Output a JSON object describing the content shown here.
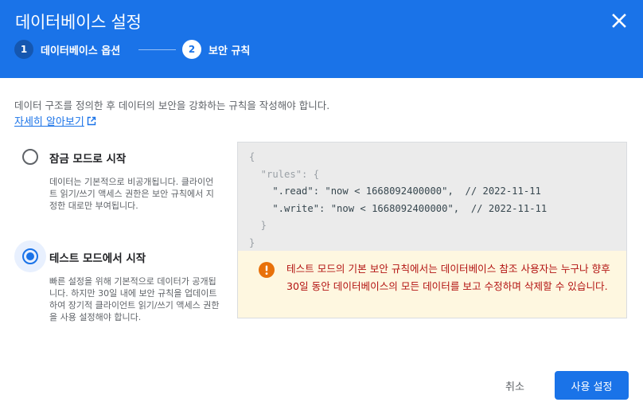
{
  "dialog": {
    "title": "데이터베이스 설정",
    "close_icon": "close-icon",
    "colors": {
      "header": "#1a73e8",
      "primary": "#1a73e8",
      "warning_text": "#b31412",
      "warning_bg": "#fef7e0",
      "warning_icon": "#e8710a"
    }
  },
  "stepper": {
    "steps": [
      {
        "number": "1",
        "label": "데이터베이스 옵션"
      },
      {
        "number": "2",
        "label": "보안 규칙"
      }
    ]
  },
  "intro": {
    "description": "데이터 구조를 정의한 후 데이터의 보안을 강화하는 규칙을 작성해야 합니다.",
    "learn_more": "자세히 알아보기",
    "learn_more_icon": "open-in-new-icon"
  },
  "options": [
    {
      "label": "잠금 모드로 시작",
      "selected": false,
      "description": "데이터는 기본적으로 비공개됩니다. 클라이언트 읽기/쓰기 액세스 권한은 보안 규칙에서 지정한 대로만 부여됩니다."
    },
    {
      "label": "테스트 모드에서 시작",
      "selected": true,
      "description": "빠른 설정을 위해 기본적으로 데이터가 공개됩니다. 하지만 30일 내에 보안 규칙을 업데이트하여 장기적 클라이언트 읽기/쓰기 액세스 권한을 사용 설정해야 합니다."
    }
  ],
  "rules_code": {
    "lines": [
      "{",
      "  \"rules\": {",
      "    \".read\": \"now < 1668092400000\",  // 2022-11-11",
      "    \".write\": \"now < 1668092400000\",  // 2022-11-11",
      "  }",
      "}"
    ]
  },
  "warning": {
    "icon": "error-icon",
    "text": "테스트 모드의 기본 보안 규칙에서는 데이터베이스 참조 사용자는 누구나 향후 30일 동안 데이터베이스의 모든 데이터를 보고 수정하며 삭제할 수 있습니다."
  },
  "actions": {
    "cancel": "취소",
    "confirm": "사용 설정"
  }
}
